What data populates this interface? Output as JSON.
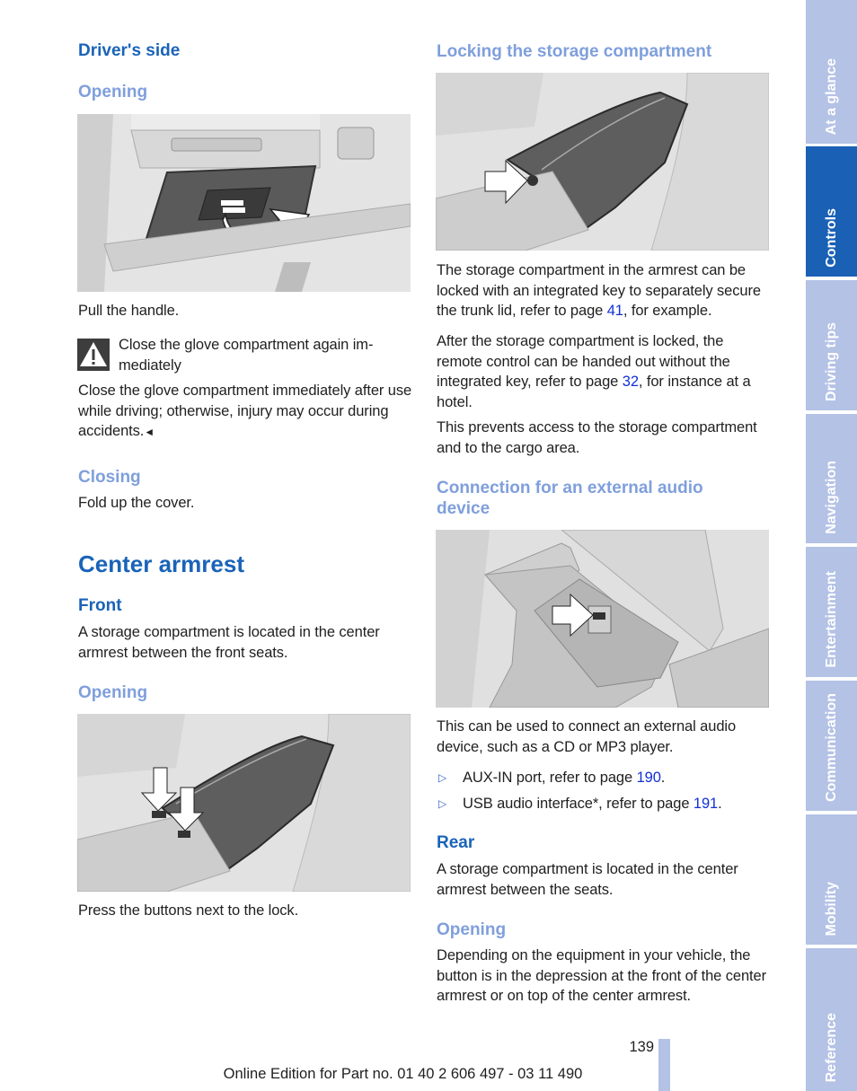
{
  "left_column": {
    "drivers_side_heading": "Driver's side",
    "opening_heading_1": "Opening",
    "figure_glove_box": "glove-compartment-handle-illustration",
    "pull_handle": "Pull the handle.",
    "warning": {
      "icon": "warning-triangle-icon",
      "title": "Close the glove compartment again im-mediately",
      "title_line1": "Close the glove compartment again im-",
      "title_line2": "mediately",
      "body": "Close the glove compartment immediately after use while driving; otherwise, injury may occur during accidents.",
      "end_mark": "◄"
    },
    "closing_heading": "Closing",
    "fold_up": "Fold up the cover.",
    "chapter_heading": "Center armrest",
    "front_heading": "Front",
    "front_text": "A storage compartment is located in the center armrest between the front seats.",
    "opening_heading_2": "Opening",
    "figure_armrest_buttons": "armrest-buttons-illustration",
    "press_buttons": "Press the buttons next to the lock."
  },
  "right_column": {
    "locking_heading": "Locking the storage compartment",
    "figure_armrest_lock": "armrest-lock-illustration",
    "locking_text": {
      "before": "The storage compartment in the armrest can be locked with an integrated key to separately secure the trunk lid, refer to page ",
      "link": "41",
      "after": ", for example."
    },
    "after_locked_text": {
      "before": "After the storage compartment is locked, the remote control can be handed out without the integrated key, refer to page ",
      "link": "32",
      "after": ", for instance at a hotel."
    },
    "prevents_text": "This prevents access to the storage compartment and to the cargo area.",
    "connection_heading": "Connection for an external audio device",
    "figure_audio": "audio-connection-illustration",
    "connection_text": "This can be used to connect an external audio device, such as a CD or MP3 player.",
    "bullets": [
      {
        "marker": "▷",
        "before": "AUX-IN port, refer to page ",
        "link": "190",
        "after": "."
      },
      {
        "marker": "▷",
        "before": "USB audio interface*, refer to page ",
        "link": "191",
        "after": "."
      }
    ],
    "rear_heading": "Rear",
    "rear_text": "A storage compartment is located in the center armrest between the seats.",
    "opening_heading_3": "Opening",
    "rear_opening_text": "Depending on the equipment in your vehicle, the button is in the depression at the front of the center armrest or on top of the center armrest."
  },
  "footer": {
    "page_number": "139",
    "edition": "Online Edition for Part no. 01 40 2 606 497 - 03 11 490"
  },
  "side_tabs": [
    {
      "label": "At a glance",
      "active": false
    },
    {
      "label": "Controls",
      "active": true
    },
    {
      "label": "Driving tips",
      "active": false
    },
    {
      "label": "Navigation",
      "active": false
    },
    {
      "label": "Entertainment",
      "active": false
    },
    {
      "label": "Communication",
      "active": false
    },
    {
      "label": "Mobility",
      "active": false
    },
    {
      "label": "Reference",
      "active": false
    }
  ],
  "colors": {
    "heading_blue": "#1a63b8",
    "subheading_blue": "#7f9fdc",
    "link_blue": "#1030d8",
    "tab_inactive": "#b3c2e5",
    "tab_active": "#1a60b5"
  }
}
